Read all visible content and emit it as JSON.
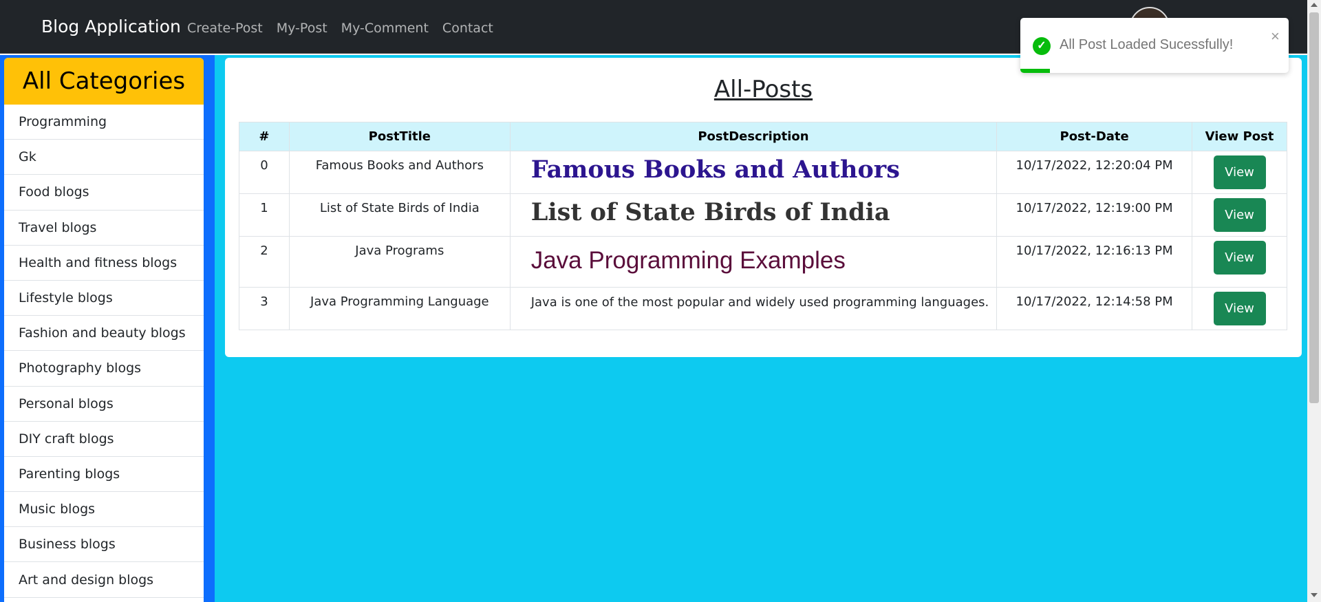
{
  "navbar": {
    "brand": "Blog Application",
    "links": [
      "Create-Post",
      "My-Post",
      "My-Comment",
      "Contact"
    ]
  },
  "sidebar": {
    "title": "All Categories",
    "items": [
      "Programming",
      "Gk",
      "Food blogs",
      "Travel blogs",
      "Health and fitness blogs",
      "Lifestyle blogs",
      "Fashion and beauty blogs",
      "Photography blogs",
      "Personal blogs",
      "DIY craft blogs",
      "Parenting blogs",
      "Music blogs",
      "Business blogs",
      "Art and design blogs"
    ]
  },
  "main": {
    "title": "All-Posts",
    "table": {
      "headers": [
        "#",
        "PostTitle",
        "PostDescription",
        "Post-Date",
        "View Post"
      ],
      "rows": [
        {
          "index": "0",
          "title": "Famous Books and Authors",
          "description": "Famous Books and Authors",
          "date": "10/17/2022, 12:20:04 PM",
          "button": "View"
        },
        {
          "index": "1",
          "title": "List of State Birds of India",
          "description": "List of State Birds of India",
          "date": "10/17/2022, 12:19:00 PM",
          "button": "View"
        },
        {
          "index": "2",
          "title": "Java Programs",
          "description": "Java Programming Examples",
          "date": "10/17/2022, 12:16:13 PM",
          "button": "View"
        },
        {
          "index": "3",
          "title": "Java Programming Language",
          "description": "Java is one of the most popular and widely used programming languages.",
          "date": "10/17/2022, 12:14:58 PM",
          "button": "View"
        }
      ]
    }
  },
  "toast": {
    "message": "All Post Loaded Sucessfully!",
    "close": "×",
    "check": "✓",
    "progress": 0.11
  },
  "colors": {
    "navbar": "#212529",
    "sidebar_accent": "#0d6efd",
    "category_header": "#ffc107",
    "main_bg": "#0dcaf0",
    "table_header": "#cff4fc",
    "view_button": "#198754",
    "toast_success": "#07bc0c"
  }
}
